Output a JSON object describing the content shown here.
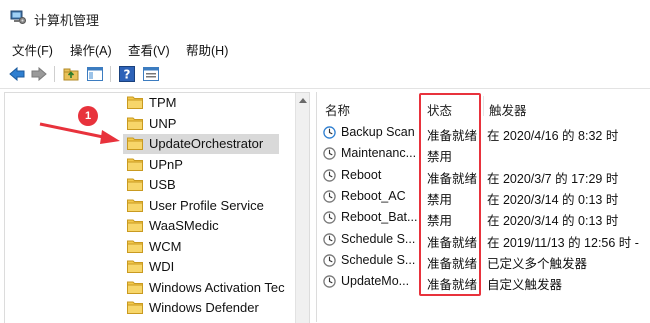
{
  "window": {
    "title": "计算机管理"
  },
  "menu": [
    "文件(F)",
    "操作(A)",
    "查看(V)",
    "帮助(H)"
  ],
  "toolbar": {
    "buttons": [
      "back-icon",
      "forward-icon",
      "up-folder-icon",
      "show-hide-tree-icon",
      "help-icon",
      "properties-icon"
    ]
  },
  "tree": {
    "items": [
      {
        "label": "TPM"
      },
      {
        "label": "UNP"
      },
      {
        "label": "UpdateOrchestrator",
        "selected": true
      },
      {
        "label": "UPnP"
      },
      {
        "label": "USB"
      },
      {
        "label": "User Profile Service"
      },
      {
        "label": "WaaSMedic"
      },
      {
        "label": "WCM"
      },
      {
        "label": "WDI"
      },
      {
        "label": "Windows Activation Tec"
      },
      {
        "label": "Windows Defender"
      }
    ]
  },
  "tasks": {
    "columns": {
      "name": "名称",
      "status": "状态",
      "trigger": "触发器"
    },
    "rows": [
      {
        "name": "Backup Scan",
        "status": "准备就绪",
        "trigger": "在 2020/4/16 的 8:32 时"
      },
      {
        "name": "Maintenanc...",
        "status": "禁用",
        "trigger": ""
      },
      {
        "name": "Reboot",
        "status": "准备就绪",
        "trigger": "在 2020/3/7 的 17:29 时"
      },
      {
        "name": "Reboot_AC",
        "status": "禁用",
        "trigger": "在 2020/3/14 的 0:13 时"
      },
      {
        "name": "Reboot_Bat...",
        "status": "禁用",
        "trigger": "在 2020/3/14 的 0:13 时"
      },
      {
        "name": "Schedule S...",
        "status": "准备就绪",
        "trigger": "在 2019/11/13 的 12:56 时 -"
      },
      {
        "name": "Schedule S...",
        "status": "准备就绪",
        "trigger": "已定义多个触发器"
      },
      {
        "name": "UpdateMo...",
        "status": "准备就绪",
        "trigger": "自定义触发器"
      }
    ]
  },
  "annotation": {
    "badge": "1",
    "color": "#e8323c"
  }
}
